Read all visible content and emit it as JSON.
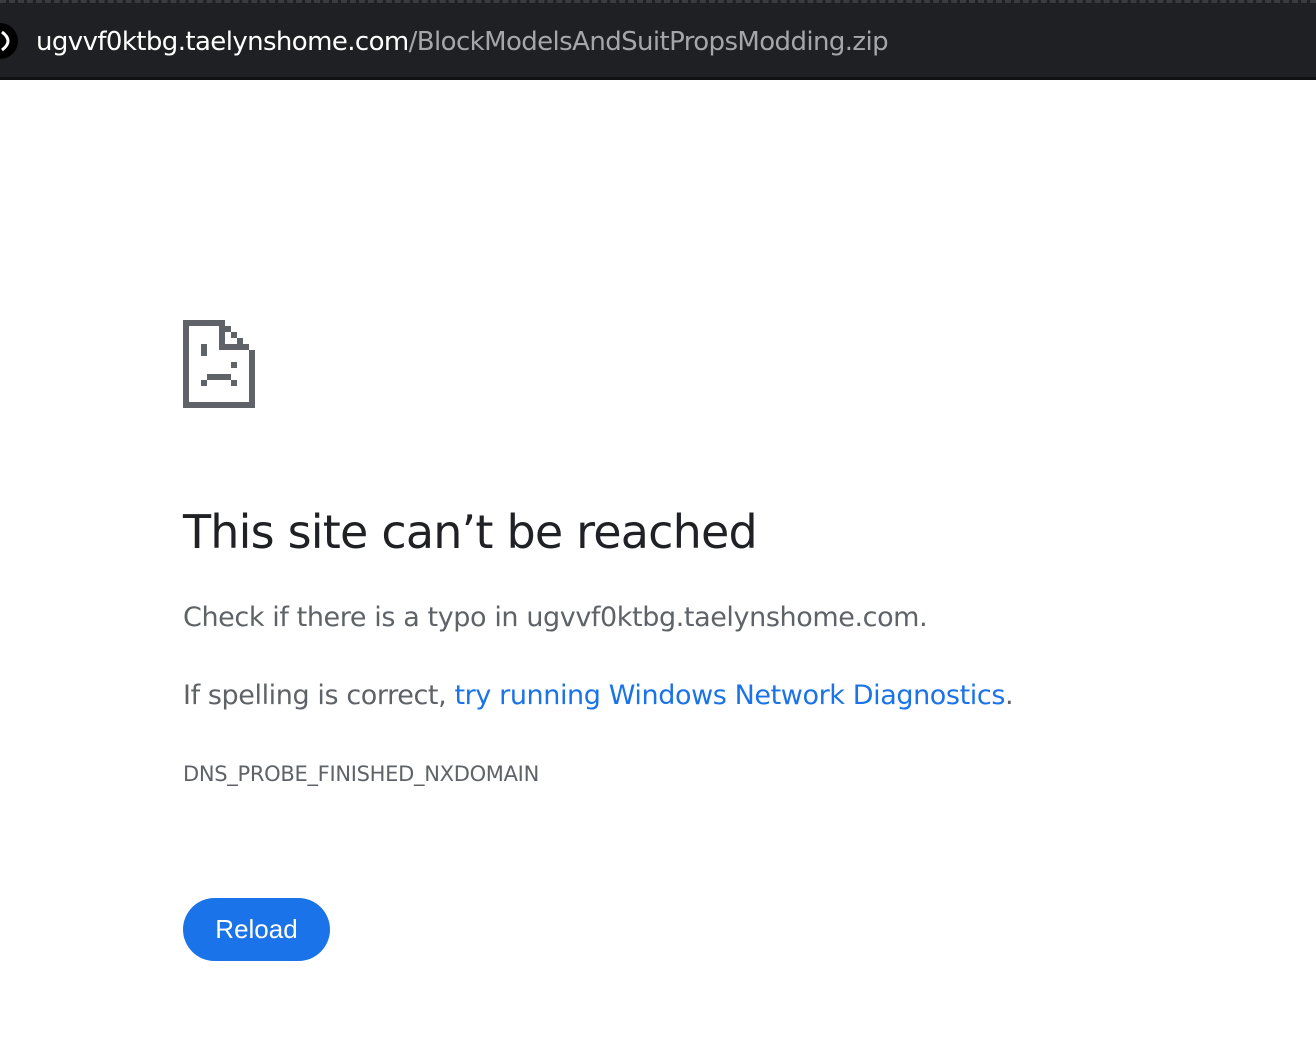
{
  "address_bar": {
    "host": "ugvvf0ktbg.taelynshome.com",
    "path": "/BlockModelsAndSuitPropsModding.zip",
    "site_info_icon": "site-info-icon"
  },
  "error_page": {
    "icon": "sad-document-icon",
    "heading": "This site can’t be reached",
    "typo_message": "Check if there is a typo in ugvvf0ktbg.taelynshome.com.",
    "spelling_prefix": "If spelling is correct, ",
    "diagnostics_link": "try running Windows Network Diagnostics",
    "spelling_suffix": ".",
    "error_code": "DNS_PROBE_FINISHED_NXDOMAIN",
    "reload_label": "Reload"
  },
  "colors": {
    "topbar_bg": "#1f2023",
    "link": "#1a73e8",
    "button": "#1a73e8",
    "heading": "#202124",
    "body_text": "#5f6368"
  }
}
